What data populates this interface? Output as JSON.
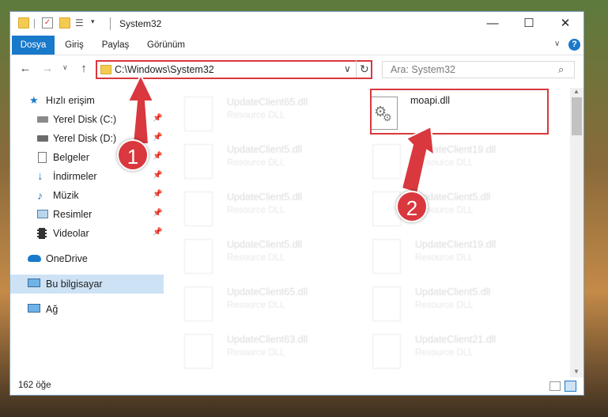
{
  "window": {
    "title": "System32"
  },
  "ribbon": {
    "tabs": [
      "Dosya",
      "Giriş",
      "Paylaş",
      "Görünüm"
    ]
  },
  "address_bar": {
    "path": "C:\\Windows\\System32"
  },
  "search": {
    "placeholder": "Ara: System32"
  },
  "sidebar": {
    "quick_access": "Hızlı erişim",
    "items": [
      {
        "label": "Yerel Disk (C:)",
        "icon": "drive-icon",
        "pinned": true
      },
      {
        "label": "Yerel Disk (D:)",
        "icon": "drive-icon",
        "pinned": true
      },
      {
        "label": "Belgeler",
        "icon": "documents-icon",
        "pinned": true
      },
      {
        "label": "İndirmeler",
        "icon": "downloads-icon",
        "pinned": true
      },
      {
        "label": "Müzik",
        "icon": "music-icon",
        "pinned": true
      },
      {
        "label": "Resimler",
        "icon": "pictures-icon",
        "pinned": true
      },
      {
        "label": "Videolar",
        "icon": "videos-icon",
        "pinned": true
      }
    ],
    "onedrive": "OneDrive",
    "this_pc": "Bu bilgisayar",
    "network": "Ağ"
  },
  "files": {
    "highlighted": {
      "name": "moapi.dll"
    },
    "left_column": [
      {
        "name": "UpdateClient65.dll",
        "type": "Resource DLL"
      },
      {
        "name": "UpdateClient5.dll",
        "type": "Resource DLL"
      },
      {
        "name": "UpdateClient5.dll",
        "type": "Resource DLL"
      },
      {
        "name": "UpdateClient5.dll",
        "type": "Resource DLL"
      },
      {
        "name": "UpdateClient65.dll",
        "type": "Resource DLL"
      },
      {
        "name": "UpdateClient63.dll",
        "type": "Resource DLL"
      }
    ],
    "right_column": [
      {
        "name": "UpdateClient19.dll",
        "type": "Resource DLL"
      },
      {
        "name": "UpdateClient5.dll",
        "type": "Resource DLL"
      },
      {
        "name": "UpdateClient19.dll",
        "type": "Resource DLL"
      },
      {
        "name": "UpdateClient5.dll",
        "type": "Resource DLL"
      },
      {
        "name": "UpdateClient21.dll",
        "type": "Resource DLL"
      }
    ]
  },
  "status": {
    "item_count": "162 öğe"
  },
  "callouts": {
    "one": "1",
    "two": "2"
  },
  "colors": {
    "accent": "#1979ca",
    "highlight": "#d9383e"
  }
}
